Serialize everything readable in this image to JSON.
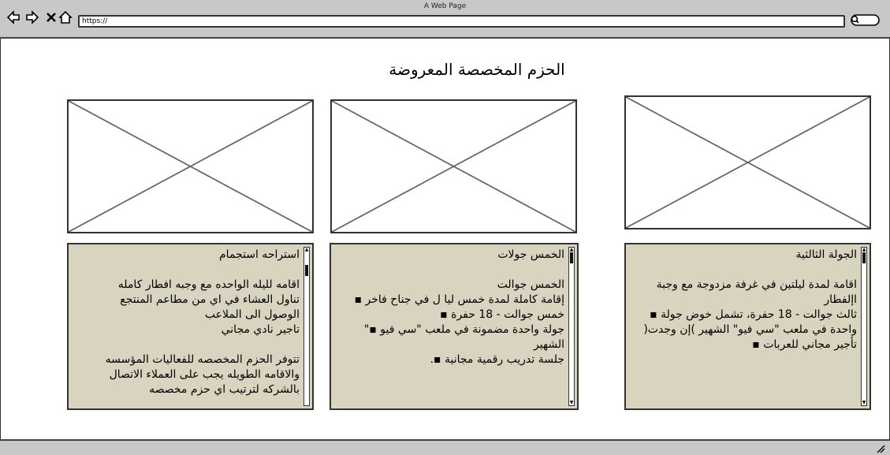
{
  "window": {
    "title": "A Web Page"
  },
  "address_bar": {
    "url": "https://"
  },
  "page": {
    "title": "الحزم المخصصة المعروضة"
  },
  "cards": [
    {
      "heading": "استراحه استجمام",
      "lines": [
        "",
        "اقامه لليله الواحده مع وجبه افطار كامله",
        "تناول العشاء في اي من مطاعم المنتجع",
        "الوصول الى الملاعب",
        "تاجير نادي مجاني",
        "",
        "تتوفر الحزم المخصصه للفعاليات المؤسسه",
        "والاقامه الطويله يجب على العملاء الاتصال",
        "بالشركه لترتيب اي حزم مخصصه"
      ]
    },
    {
      "heading": "الخمس جولات",
      "lines": [
        "",
        "الخمس جوالت",
        "إقامة كاملة لمدة خمس ليا ل في جناح فاخر ▪",
        "خمس جوالت - 18 حفرة ▪",
        "جولة واحدة مضمونة في ملعب \"سي فيو ▪\"",
        "الشهير",
        "جلسة تدريب رقمية مجانية ▪."
      ]
    },
    {
      "heading": "الجولة الثالثية",
      "lines": [
        "",
        "اقامة لمدة ليلتين في غرفة مزدوجة مع وجبة",
        "اإلفطار",
        "ثالث جوالت - 18 حفرة، تشمل خوض جولة ▪",
        "واحدة في ملعب \"سي فيو\" الشهير )إن وجدت(",
        "تأجير مجاني للعربات ▪"
      ]
    }
  ],
  "icons": [
    "back-arrow-icon",
    "forward-arrow-icon",
    "close-icon",
    "home-icon",
    "search-icon",
    "resize-grip-icon"
  ]
}
